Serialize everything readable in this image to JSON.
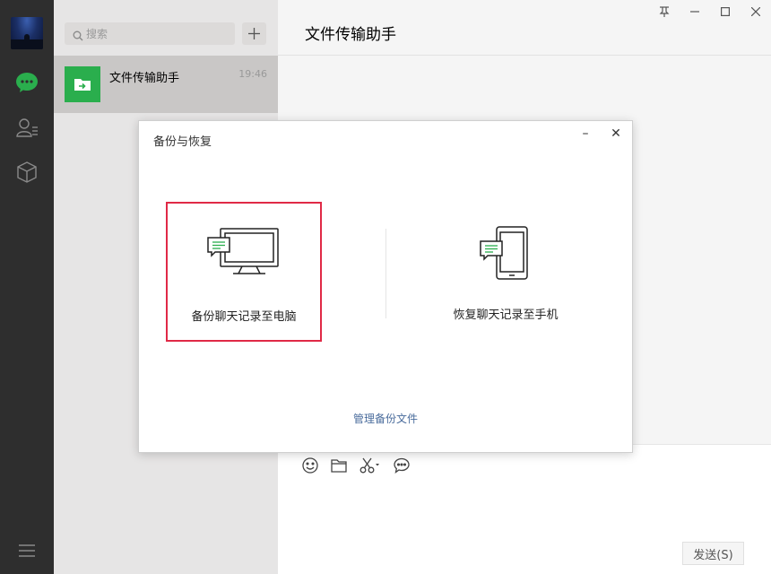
{
  "nav": {
    "items": [
      {
        "icon": "chat-icon",
        "active": true
      },
      {
        "icon": "contacts-icon",
        "active": false
      },
      {
        "icon": "cube-icon",
        "active": false
      }
    ],
    "menu_icon": "menu-icon"
  },
  "list": {
    "search_placeholder": "搜索",
    "add_label": "+",
    "chats": [
      {
        "name": "文件传输助手",
        "time": "19:46"
      }
    ]
  },
  "main": {
    "chat_title": "文件传输助手",
    "window_controls": {
      "pin": "⫫",
      "minimize": "–",
      "maximize": "☐",
      "close": "✕"
    },
    "send_label": "发送(S)"
  },
  "dialog": {
    "title": "备份与恢复",
    "minimize": "–",
    "close": "✕",
    "backup_label": "备份聊天记录至电脑",
    "restore_label": "恢复聊天记录至手机",
    "manage_label": "管理备份文件"
  },
  "colors": {
    "accent_green": "#2aae4d",
    "link_blue": "#4a6c9c",
    "highlight_red": "#e02946"
  }
}
